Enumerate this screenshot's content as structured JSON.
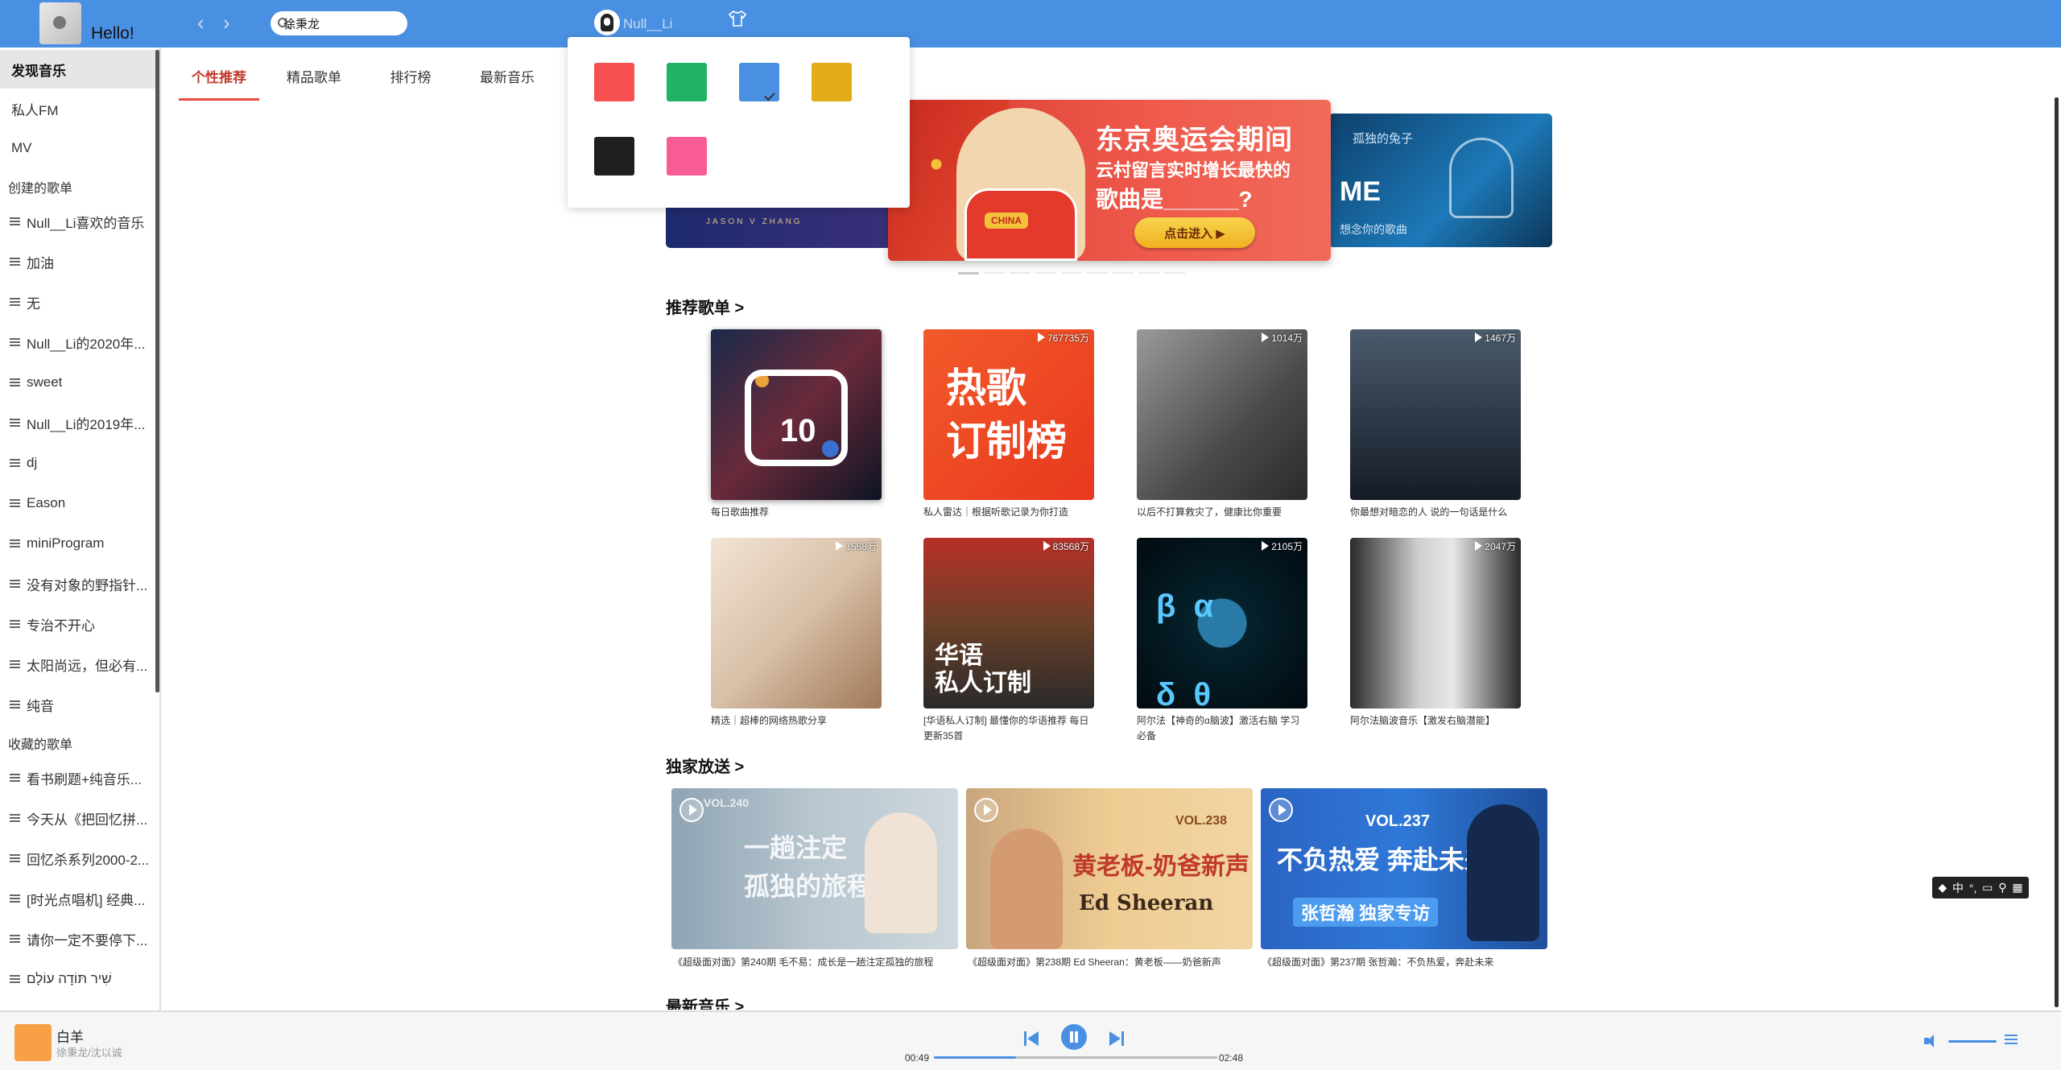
{
  "header": {
    "greeting": "Hello!",
    "nav_back": "‹",
    "nav_forward": "›",
    "search_value": "徐秉龙",
    "user_name": "Null__Li",
    "skin_icon": "tshirt-icon",
    "color": "#4a90e2"
  },
  "skin_popup": {
    "colors": [
      "#f65050",
      "#21b365",
      "#4a90e2",
      "#e3aa1a",
      "#1f1f1f",
      "#f95b96"
    ],
    "selected": "#4a90e2"
  },
  "sidebar": {
    "nav": [
      "发现音乐",
      "私人FM",
      "MV"
    ],
    "created_title": "创建的歌单",
    "created": [
      "Null__Li喜欢的音乐",
      "加油",
      "无",
      "Null__Li的2020年...",
      "sweet",
      "Null__Li的2019年...",
      "dj",
      "Eason",
      "miniProgram",
      "没有对象的野指针...",
      "专治不开心",
      "太阳尚远，但必有...",
      "纯音"
    ],
    "collected_title": "收藏的歌单",
    "collected": [
      "看书刷题+纯音乐...",
      "今天从《把回忆拼...",
      "回忆杀系列2000-2...",
      "[时光点唱机] 经典...",
      "请你一定不要停下...",
      "שִׁיר תּוֹדָה עוֹלָם"
    ]
  },
  "tabs": [
    "个性推荐",
    "精品歌单",
    "排行榜",
    "最新音乐"
  ],
  "banner": {
    "left_caption": "JASON  V  ZHANG",
    "center_line1": "东京奥运会期间",
    "center_line2": "云村留言实时增长最快的",
    "center_line3": "歌曲是______?",
    "center_badge": "CHINA",
    "center_cta": "点击进入 ▶",
    "right_line1": "孤独的兔子",
    "right_line2": "ME",
    "right_line3": "想念你的歌曲"
  },
  "sections": {
    "recommended": "推荐歌单 >",
    "exclusive": "独家放送 >",
    "newest": "最新音乐 >"
  },
  "playlists": [
    {
      "title": "每日歌曲推荐",
      "count": "",
      "cover_text": "10"
    },
    {
      "title": "私人雷达｜根据听歌记录为你打造",
      "count": "767735万",
      "cover_text": "热歌\n订制榜"
    },
    {
      "title": "以后不打算救灾了，健康比你重要",
      "count": "1014万",
      "cover_text": ""
    },
    {
      "title": "你最想对暗恋的人 说的一句话是什么",
      "count": "1467万",
      "cover_text": ""
    },
    {
      "title": "精选｜超棒的网络热歌分享",
      "count": "1568万",
      "cover_text": ""
    },
    {
      "title": "[华语私人订制] 最懂你的华语推荐 每日更新35首",
      "count": "83568万",
      "cover_text": "华语\n私人订制"
    },
    {
      "title": "阿尔法【神奇的α脑波】激活右脑 学习必备",
      "count": "2105万",
      "cover_text": "β  α\nδ  θ"
    },
    {
      "title": "阿尔法脑波音乐【激发右脑潜能】",
      "count": "2047万",
      "cover_text": ""
    }
  ],
  "exclusive": [
    {
      "caption": "《超级面对面》第240期 毛不易：成长是一趟注定孤独的旅程",
      "label": "一趟注定\n孤独的旅程",
      "vol": "VOL.240"
    },
    {
      "caption": "《超级面对面》第238期 Ed Sheeran：黄老板——奶爸新声",
      "label": "黄老板-奶爸新声",
      "vol": "VOL.238",
      "sub": "Ed Sheeran"
    },
    {
      "caption": "《超级面对面》第237期 张哲瀚：不负热爱，奔赴未来",
      "label": "不负热爱 奔赴未来",
      "vol": "VOL.237",
      "sub": "张哲瀚 独家专访"
    }
  ],
  "player": {
    "title": "白羊",
    "artist": "徐秉龙/沈以诚",
    "current_time": "00:49",
    "total_time": "02:48",
    "progress": 0.29
  },
  "ime": {
    "text": "中"
  }
}
